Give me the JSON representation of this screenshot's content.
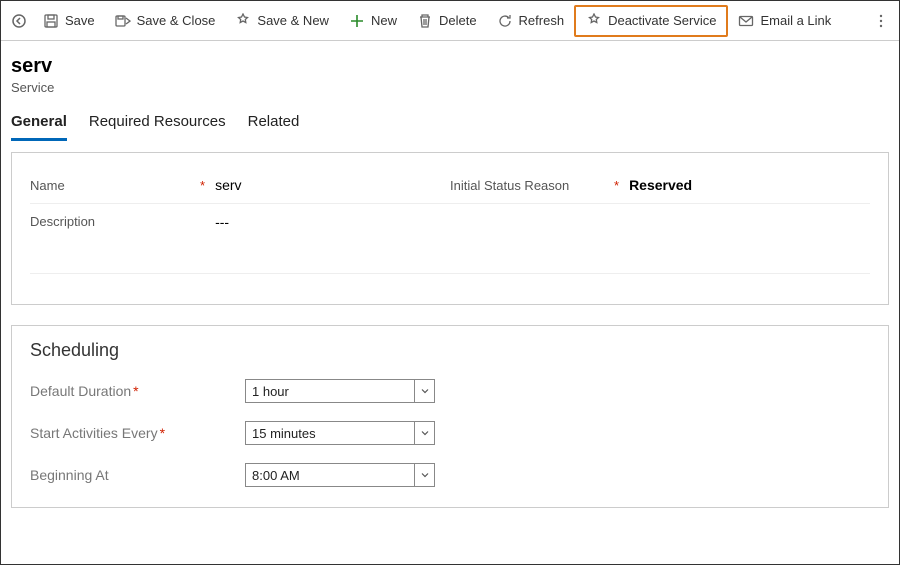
{
  "toolbar": {
    "save": "Save",
    "save_close": "Save & Close",
    "save_new": "Save & New",
    "new": "New",
    "delete": "Delete",
    "refresh": "Refresh",
    "deactivate": "Deactivate Service",
    "email_link": "Email a Link"
  },
  "header": {
    "title": "serv",
    "subtitle": "Service"
  },
  "tabs": {
    "general": "General",
    "required_resources": "Required Resources",
    "related": "Related"
  },
  "fields": {
    "name_label": "Name",
    "name_value": "serv",
    "status_label": "Initial Status Reason",
    "status_value": "Reserved",
    "description_label": "Description",
    "description_value": "---"
  },
  "scheduling": {
    "title": "Scheduling",
    "default_duration_label": "Default Duration",
    "default_duration_value": "1 hour",
    "start_every_label": "Start Activities Every",
    "start_every_value": "15 minutes",
    "beginning_at_label": "Beginning At",
    "beginning_at_value": "8:00 AM"
  }
}
